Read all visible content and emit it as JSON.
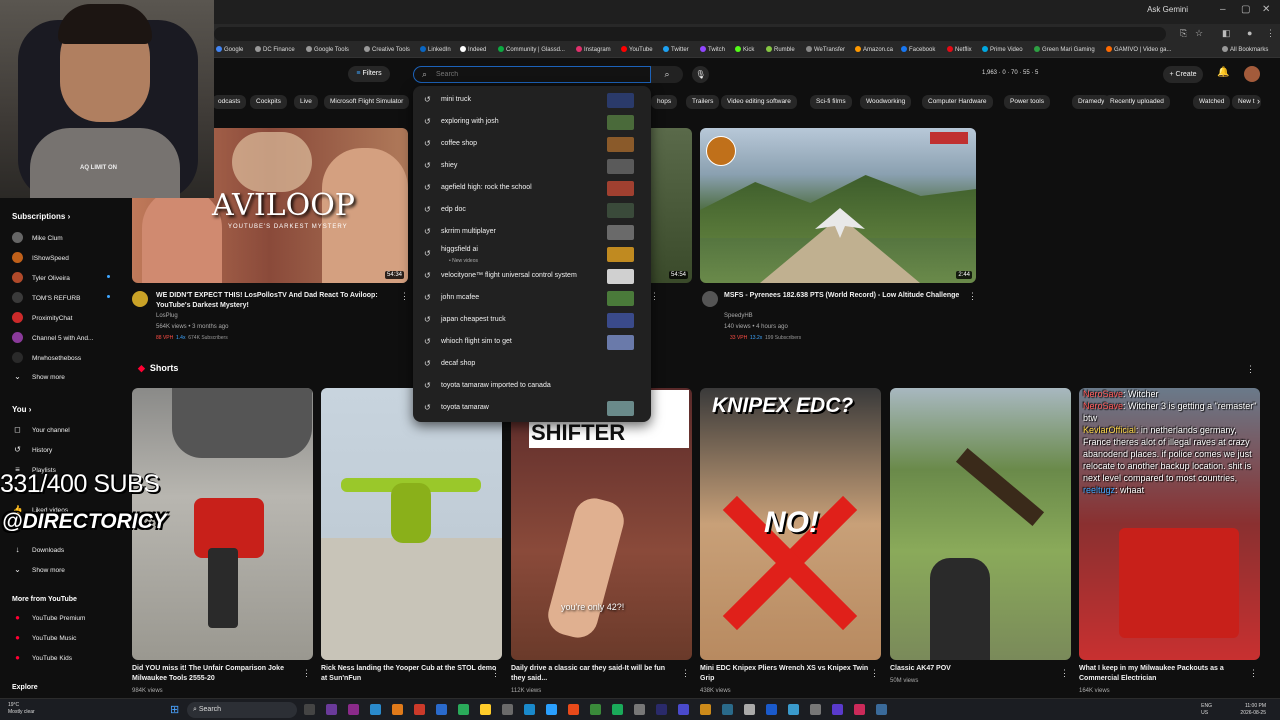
{
  "browser": {
    "ask_label": "Ask Gemini",
    "bookmarks": [
      "Google",
      "DC Finance",
      "Google Tools",
      "Creative Tools",
      "LinkedIn",
      "Indeed",
      "Community | Glassd...",
      "Instagram",
      "YouTube",
      "Twitter",
      "Twitch",
      "Kick",
      "Rumble",
      "WeTransfer",
      "Amazon.ca",
      "Facebook",
      "Netflix",
      "Prime Video",
      "Green Mari Gaming",
      "GAMIVO | Video ga..."
    ],
    "all_bookmarks": "All Bookmarks"
  },
  "header": {
    "filters_label": "Filters",
    "search_placeholder": "Search",
    "stats": "1,963 · 0 · 70 · 55 · 5",
    "create_label": "Create"
  },
  "chips": [
    "odcasts",
    "Cockpits",
    "Live",
    "Microsoft Flight Simulator",
    "hops",
    "Trailers",
    "Video editing software",
    "Sci-fi films",
    "Woodworking",
    "Computer Hardware",
    "Power tools",
    "Dramedy",
    "Recently uploaded",
    "Watched",
    "New t"
  ],
  "suggestions": [
    {
      "text": "mini truck",
      "sub": "",
      "thumb": "#2a3a6a"
    },
    {
      "text": "exploring with josh",
      "sub": "",
      "thumb": "#4a6a3a"
    },
    {
      "text": "coffee shop",
      "sub": "",
      "thumb": "#8a5a2a"
    },
    {
      "text": "shiey",
      "sub": "",
      "thumb": "#5a5a5a"
    },
    {
      "text": "agefield high: rock the school",
      "sub": "",
      "thumb": "#a04030"
    },
    {
      "text": "edp doc",
      "sub": "",
      "thumb": "#3a4a3a"
    },
    {
      "text": "skrrim multiplayer",
      "sub": "",
      "thumb": "#6a6a6a"
    },
    {
      "text": "higgsfield ai",
      "sub": "• New videos",
      "thumb": "#c08a20"
    },
    {
      "text": "velocityone™ flight universal control system",
      "sub": "",
      "thumb": "#d0d0d0"
    },
    {
      "text": "john mcafee",
      "sub": "",
      "thumb": "#4a7a3a"
    },
    {
      "text": "japan cheapest truck",
      "sub": "",
      "thumb": "#3a4a8a"
    },
    {
      "text": "whioch flight sim to get",
      "sub": "",
      "thumb": "#6a7aaa"
    },
    {
      "text": "decaf shop",
      "sub": "",
      "thumb": ""
    },
    {
      "text": "toyota tamaraw imported to canada",
      "sub": "",
      "thumb": ""
    },
    {
      "text": "toyota tamaraw",
      "sub": "",
      "thumb": "#6a8a8a"
    }
  ],
  "sidebar": {
    "subscriptions_label": "Subscriptions",
    "channels": [
      {
        "name": "Mike Clum",
        "color": "#666"
      },
      {
        "name": "IShowSpeed",
        "color": "#c0601a"
      },
      {
        "name": "Tyler Oliveira",
        "color": "#b04a2a"
      },
      {
        "name": "TOM'S REFURB",
        "color": "#3a3a3a"
      },
      {
        "name": "ProximityChat",
        "color": "#cc2a2a"
      },
      {
        "name": "Channel 5 with And...",
        "color": "#8a3a9a"
      },
      {
        "name": "Mrwhosetheboss",
        "color": "#2a2a2a"
      }
    ],
    "show_more": "Show more",
    "you_label": "You",
    "you_items": [
      "Your channel",
      "History",
      "Playlists",
      "Liked videos",
      "Downloads"
    ],
    "show_more_2": "Show more",
    "more_label": "More from YouTube",
    "more_items": [
      "YouTube Premium",
      "YouTube Music",
      "YouTube Kids"
    ],
    "explore_label": "Explore"
  },
  "overlay": {
    "subs": "331/400 SUBS",
    "handle": "@DIRECTORICY",
    "shirt": "AQ LIMIT ON"
  },
  "videos": [
    {
      "title": "WE DIDN'T EXPECT THIS! LosPollosTV And Dad React To Aviloop: YouTube's Darkest Mystery!",
      "channel": "LosPlug",
      "meta": "564K views • 3 months ago",
      "vph": "88 VPH",
      "ratio": "1.4x",
      "subs": "674K Subscribers",
      "duration": "54:34",
      "thumb_title": "AVILOOP",
      "thumb_sub": "YOUTUBE'S DARKEST MYSTERY"
    },
    {
      "title": "MSFS - Pyrenees 182.638 PTS (World Record) - Low Altitude Challenge",
      "channel": "SpeedyHB",
      "meta": "140 views • 4 hours ago",
      "vph": "33 VPH",
      "ratio": "13.2x",
      "subs": "199 Subscribers",
      "duration": "2:44"
    },
    {
      "duration": "54:54"
    }
  ],
  "shorts_label": "Shorts",
  "shorts": [
    {
      "title": "Did YOU miss it! The Unfair Comparison Joke Milwaukee Tools 2555-20",
      "views": "984K views",
      "overlay": ""
    },
    {
      "title": "Rick Ness landing the Yooper Cub at the STOL demo at Sun'nFun",
      "views": "",
      "overlay": ""
    },
    {
      "title": "Daily drive a classic car they said-It will be fun they said...",
      "views": "112K views",
      "overlay": "SHIFTER",
      "caption": "you're only 42?!"
    },
    {
      "title": "Mini EDC Knipex Pliers Wrench XS vs Knipex Twin Grip",
      "views": "438K views",
      "overlay": "KNIPEX EDC?",
      "no": "NO!"
    },
    {
      "title": "Classic AK47 POV",
      "views": "50M views",
      "overlay": ""
    },
    {
      "title": "What I keep in my Milwaukee Packouts as a Commercial Electrician",
      "views": "164K views",
      "overlay": "",
      "chat": [
        {
          "user": "NeroSave",
          "msg": "Witcher"
        },
        {
          "user": "NeroSave",
          "msg": "Witcher 3 is getting a \"remaster\" btw"
        },
        {
          "user": "KevlarOfficial",
          "msg": "in netherlands germany, France theres alot of illegal raves at crazy abanodend places. if police comes we just relocate to another backup location. shit is next level compared to most countries,"
        },
        {
          "user": "reeltugz",
          "msg": "whaat"
        }
      ]
    }
  ],
  "taskbar": {
    "search_label": "Search",
    "weather_temp": "19°C",
    "weather_desc": "Mostly clear",
    "lang": "ENG",
    "lang2": "US",
    "time": "11:00 PM",
    "date": "2026-08-25"
  },
  "colors": {
    "accent_blue": "#3ea6ff",
    "yt_red": "#ff0033",
    "bg": "#0f0f0f"
  }
}
